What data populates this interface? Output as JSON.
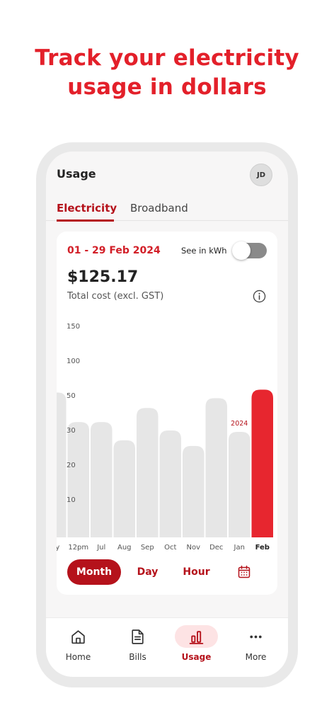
{
  "promo": {
    "line1": "Track your electricity",
    "line2": "usage in dollars"
  },
  "header": {
    "title": "Usage",
    "avatar_initials": "JD"
  },
  "tabs": [
    {
      "label": "Electricity",
      "active": true
    },
    {
      "label": "Broadband",
      "active": false
    }
  ],
  "summary": {
    "period": "01 - 29 Feb 2024",
    "toggle_label": "See in kWh",
    "toggle_on": false,
    "amount": "$125.17",
    "amount_caption": "Total cost (excl. GST)"
  },
  "chart_data": {
    "type": "bar",
    "categories": [
      "ay",
      "12pm",
      "Jul",
      "Aug",
      "Sep",
      "Oct",
      "Nov",
      "Dec",
      "Jan",
      "Feb"
    ],
    "values": [
      103,
      82,
      82,
      69,
      92,
      76,
      65,
      99,
      75,
      105
    ],
    "y_tick_labels": [
      "150",
      "100",
      "50",
      "30",
      "20",
      "10"
    ],
    "highlight_index": 9,
    "year_label": "2024",
    "year_label_index": 8,
    "colors": {
      "bar": "#e6e6e6",
      "highlight": "#e7262f",
      "label": "#555555",
      "year": "#b5121b"
    }
  },
  "view_modes": {
    "items": [
      {
        "label": "Month",
        "active": true
      },
      {
        "label": "Day",
        "active": false
      },
      {
        "label": "Hour",
        "active": false
      }
    ],
    "calendar_icon": "calendar-icon"
  },
  "bottom_nav": [
    {
      "label": "Home",
      "icon": "home-icon",
      "active": false
    },
    {
      "label": "Bills",
      "icon": "document-icon",
      "active": false
    },
    {
      "label": "Usage",
      "icon": "bar-chart-icon",
      "active": true
    },
    {
      "label": "More",
      "icon": "more-icon",
      "active": false
    }
  ],
  "colors": {
    "brand_red": "#e3202a",
    "dark_red": "#b5121b",
    "toggle_off": "#8a8a8a"
  }
}
